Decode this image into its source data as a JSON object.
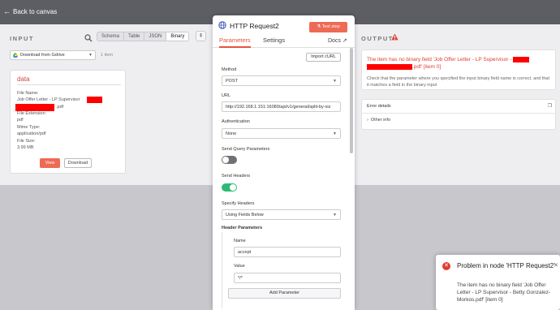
{
  "topbar": {
    "back_label": "Back to canvas"
  },
  "input": {
    "title": "INPUT",
    "modes": [
      "Schema",
      "Table",
      "JSON",
      "Binary"
    ],
    "active_mode": "Binary",
    "source": "Download from Gdrive",
    "item_count": "1 item",
    "card": {
      "title": "data",
      "file_name_label": "File Name:",
      "file_name_prefix": "Job Offer Letter - LP Supervisor",
      "file_name_suffix": ".pdf",
      "file_ext_label": "File Extension:",
      "file_ext": "pdf",
      "mime_label": "Mime Type:",
      "mime": "application/pdf",
      "size_label": "File Size:",
      "size": "3.99 MB",
      "view_label": "View",
      "download_label": "Download"
    }
  },
  "node": {
    "title": "HTTP Request2",
    "test_label": "Test step",
    "tabs": {
      "parameters": "Parameters",
      "settings": "Settings",
      "docs": "Docs"
    },
    "import_label": "Import cURL",
    "method_label": "Method",
    "method": "POST",
    "url_label": "URL",
    "url": "http://192.168.1.151:16080/api/v1/general/split-by-siz",
    "auth_label": "Authentication",
    "auth": "None",
    "send_query_label": "Send Query Parameters",
    "send_headers_label": "Send Headers",
    "specify_headers_label": "Specify Headers",
    "specify_headers": "Using Fields Below",
    "header_params_label": "Header Parameters",
    "name_label": "Name",
    "name_value": "accept",
    "value_label": "Value",
    "value_value": "*/*",
    "add_param_label": "Add Parameter"
  },
  "output": {
    "title": "OUTPUT",
    "error_title_prefix": "The item has no binary field 'Job Offer Letter - LP Supervisor -",
    "error_title_suffix": ".pdf' [item 0]",
    "error_desc": "Check that the parameter where you specified the input binary field name is correct, and that it matches a field in the binary input",
    "details_label": "Error details",
    "other_info_label": "Other info"
  },
  "toast": {
    "title": "Problem in node 'HTTP Request2'",
    "body": "The item has no binary field 'Job Offer Letter - LP Supervisor - Betty Gonzalez-Morkos.pdf' [item 0]"
  },
  "colors": {
    "accent": "#ee6a55",
    "error": "#e03c31",
    "toggle_on": "#2eba74",
    "redaction": "#ff0000"
  },
  "icons": [
    "arrow-left-icon",
    "search-icon",
    "pin-icon",
    "gdrive-icon",
    "globe-icon",
    "flask-icon",
    "external-link-icon",
    "warning-icon",
    "copy-icon",
    "chevron-right-icon",
    "error-circle-icon",
    "close-icon",
    "chevron-down-icon"
  ]
}
